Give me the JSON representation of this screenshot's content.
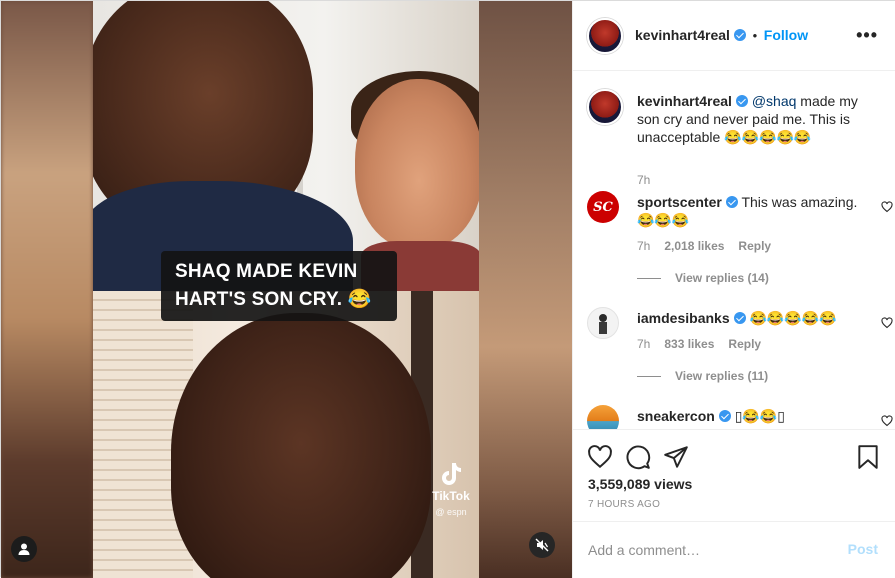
{
  "video": {
    "caption_line1": "SHAQ MADE KEVIN",
    "caption_line2": "HART'S SON CRY. 😂",
    "tiktok_label": "TikTok",
    "tiktok_user": "@ espn"
  },
  "post_header": {
    "username": "kevinhart4real",
    "separator": "•",
    "follow_label": "Follow",
    "more_label": "•••"
  },
  "caption": {
    "username": "kevinhart4real",
    "mention": "@shaq",
    "text": " made my son cry and never paid me. This is unacceptable 😂😂😂😂😂",
    "time": "7h"
  },
  "comments": [
    {
      "username": "sportscenter",
      "avatar_text": "SC",
      "text": "This was amazing. 😂😂😂",
      "time": "7h",
      "likes": "2,018 likes",
      "reply_label": "Reply",
      "view_replies": "View replies (14)"
    },
    {
      "username": "iamdesibanks",
      "text": "😂😂😂😂😂",
      "time": "7h",
      "likes": "833 likes",
      "reply_label": "Reply",
      "view_replies": "View replies (11)"
    },
    {
      "username": "sneakercon",
      "text": "▯😂😂▯"
    }
  ],
  "stats": {
    "views": "3,559,089 views",
    "posted": "7 HOURS AGO"
  },
  "add_comment": {
    "placeholder": "Add a comment…",
    "post_label": "Post"
  },
  "colors": {
    "accent": "#0095f6",
    "verified": "#3897f0",
    "muted": "#8e8e8e",
    "post_disabled": "#b2dffc"
  }
}
